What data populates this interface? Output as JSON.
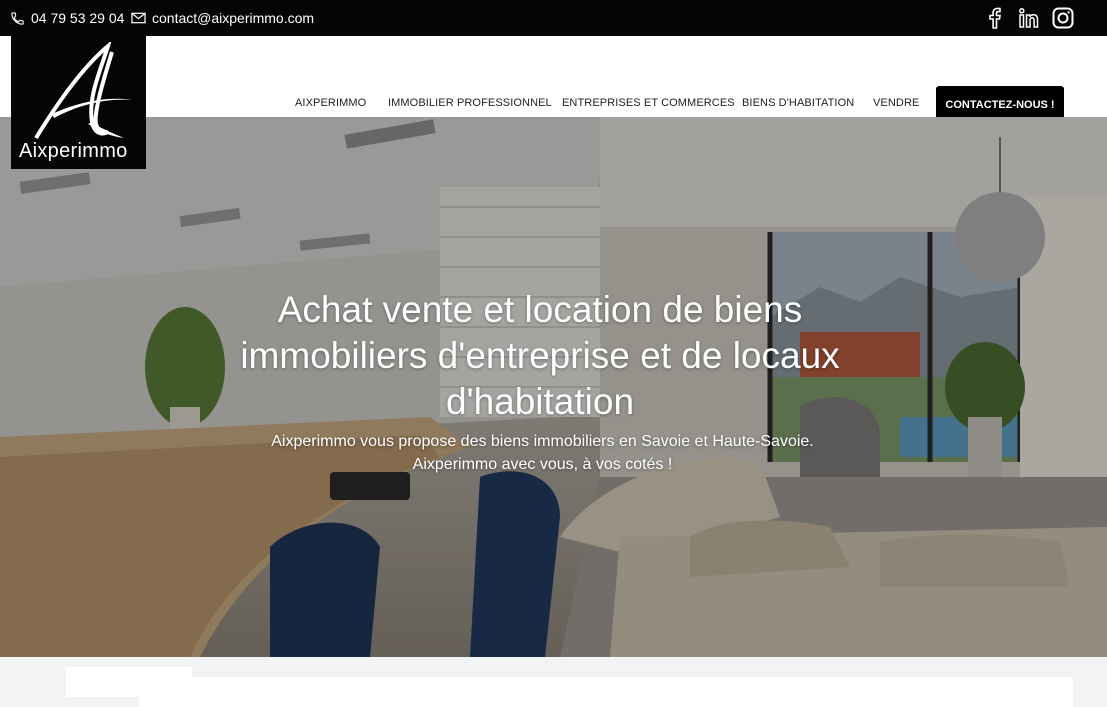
{
  "topbar": {
    "phone": "04 79 53 29 04",
    "email": "contact@aixperimmo.com",
    "phone_icon": "phone-icon",
    "mail_icon": "mail-icon",
    "social": [
      "facebook-icon",
      "linkedin-icon",
      "instagram-icon"
    ]
  },
  "logo": {
    "wordmark": "Aixperimmo"
  },
  "nav": {
    "items": [
      "AIXPERIMMO",
      "IMMOBILIER PROFESSIONNEL",
      "ENTREPRISES ET COMMERCES",
      "BIENS D'HABITATION",
      "VENDRE"
    ],
    "cta": "CONTACTEZ-NOUS !"
  },
  "hero": {
    "title": "Achat vente et location de biens immobiliers d'entreprise et de locaux d'habitation",
    "subtitle_line1": "Aixperimmo vous propose des biens immobiliers en Savoie et Haute-Savoie.",
    "subtitle_line2": "Aixperimmo avec vous, à vos cotés !"
  },
  "colors": {
    "topbar_bg": "#050505",
    "cta_bg": "#000000",
    "text_white": "#ffffff"
  }
}
